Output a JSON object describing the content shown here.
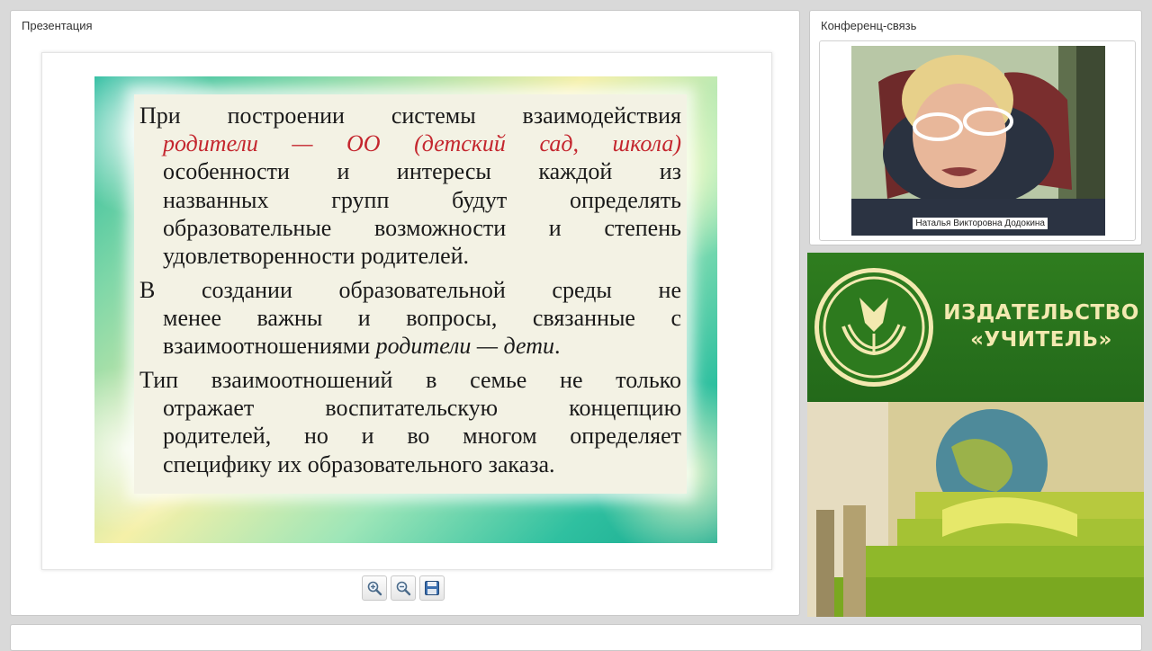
{
  "presentation": {
    "title": "Презентация",
    "slide": {
      "paragraphs": [
        {
          "lines": [
            {
              "text": "При построении системы взаимодействия",
              "style": "normal"
            },
            {
              "text": "родители — ОО (детский сад, школа)",
              "style": "red-italic"
            },
            {
              "text": "особенности и интересы каждой из",
              "style": "normal"
            },
            {
              "text": "названных групп будут определять",
              "style": "normal"
            },
            {
              "text": "образовательные возможности и степень",
              "style": "normal"
            },
            {
              "text": "удовлетворенности родителей.",
              "style": "normal"
            }
          ]
        },
        {
          "lines": [
            {
              "text": "В создании образовательной среды не",
              "style": "normal"
            },
            {
              "text": "менее важны и вопросы, связанные с",
              "style": "normal"
            },
            {
              "text": "взаимоотношениями",
              "style": "normal",
              "italic_suffix": "родители — дети",
              "tail": "."
            }
          ]
        },
        {
          "lines": [
            {
              "text": "Тип взаимоотношений в семье не только",
              "style": "normal"
            },
            {
              "text": "отражает воспитательскую концепцию",
              "style": "normal"
            },
            {
              "text": "родителей, но и во многом определяет",
              "style": "normal"
            },
            {
              "text": "специфику их образовательного заказа.",
              "style": "normal"
            }
          ]
        }
      ]
    },
    "toolbar": {
      "zoom_in_icon": "zoom-in-icon",
      "zoom_out_icon": "zoom-out-icon",
      "save_icon": "floppy-disk-icon"
    }
  },
  "conference": {
    "title": "Конференц-связь",
    "participant_name": "Наталья Викторовна Додокина"
  },
  "ad": {
    "brand_line1": "ИЗДАТЕЛЬСТВО",
    "brand_line2": "«УЧИТЕЛЬ»",
    "colors": {
      "green": "#2f7d1f",
      "gold": "#f3e9b0"
    }
  }
}
